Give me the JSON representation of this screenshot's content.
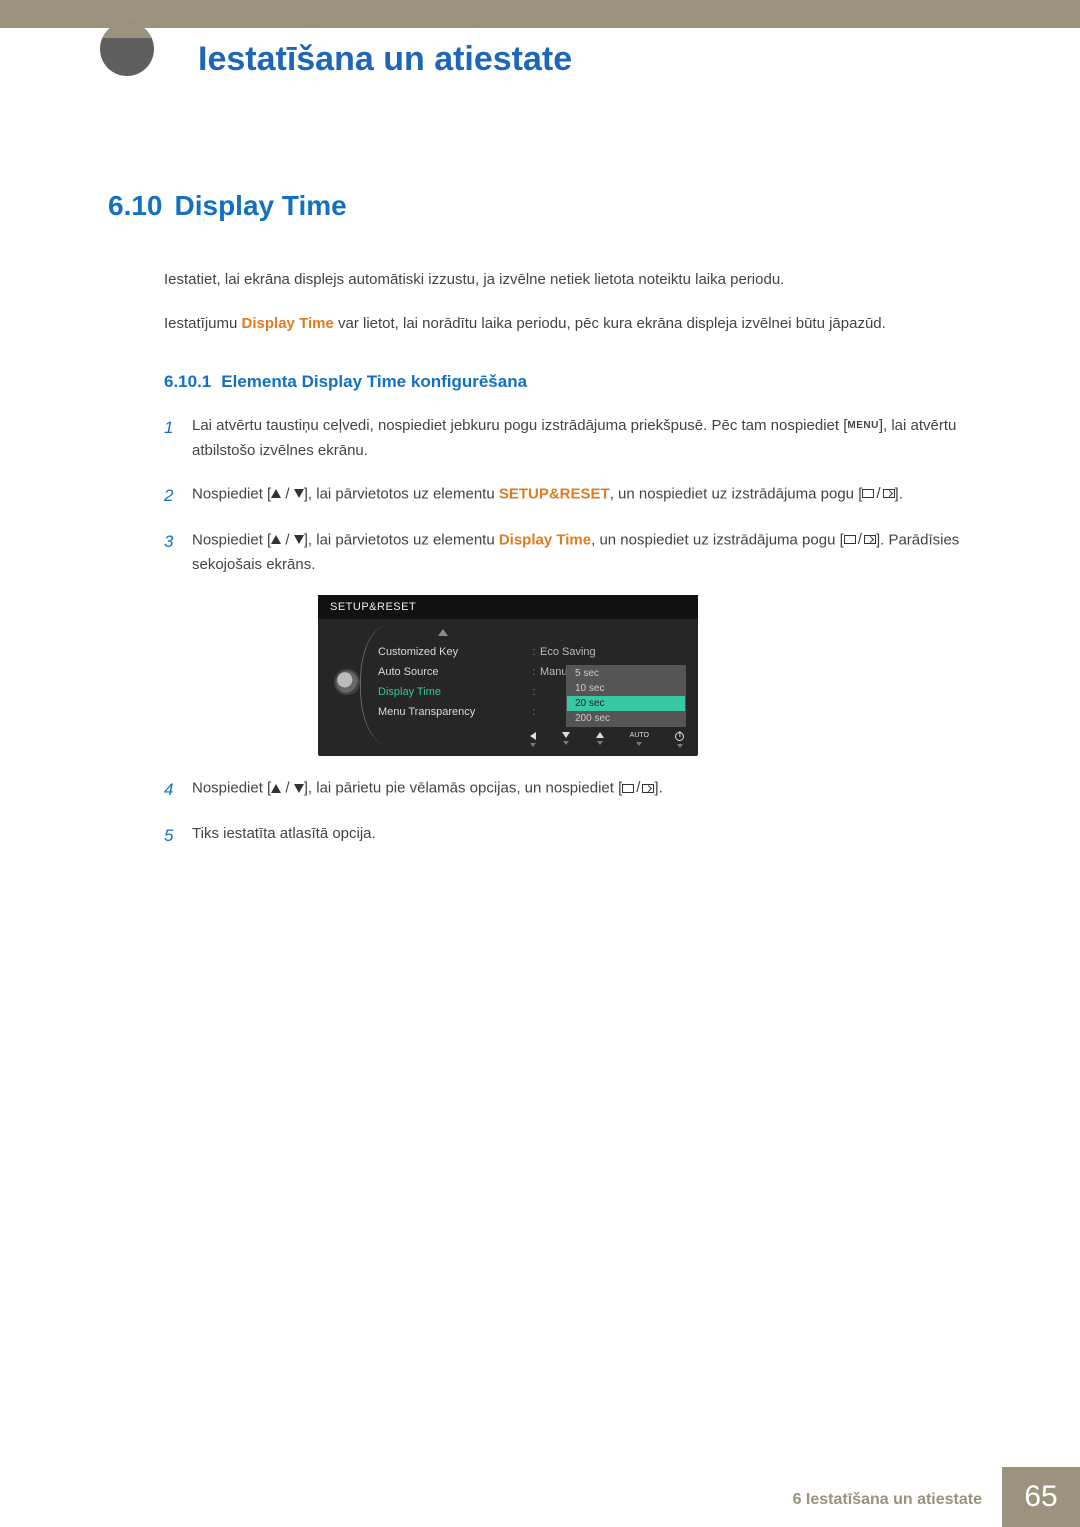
{
  "header": {
    "chapter_title": "Iestatīšana un atiestate"
  },
  "section": {
    "number": "6.10",
    "title": "Display Time",
    "intro1": "Iestatiet, lai ekrāna displejs automātiski izzustu, ja izvēlne netiek lietota noteiktu laika periodu.",
    "intro2_pre": "Iestatījumu ",
    "intro2_em": "Display Time",
    "intro2_post": " var lietot, lai norādītu laika periodu, pēc kura ekrāna displeja izvēlnei būtu jāpazūd."
  },
  "subsection": {
    "number": "6.10.1",
    "title": "Elementa Display Time konfigurēšana"
  },
  "steps": {
    "s1a": "Lai atvērtu taustiņu ceļvedi, nospiediet jebkuru pogu izstrādājuma priekšpusē. Pēc tam nospiediet [",
    "s1b": "], lai atvērtu atbilstošo izvēlnes ekrānu.",
    "menu_symbol": "MENU",
    "s2a": "Nospiediet [",
    "s2b": "], lai pārvietotos uz elementu ",
    "s2_em": "SETUP&RESET",
    "s2c": ", un nospiediet uz izstrādājuma pogu [",
    "s2d": "].",
    "s3a": "Nospiediet [",
    "s3b": "], lai pārvietotos uz elementu ",
    "s3_em": "Display Time",
    "s3c": ", un nospiediet uz izstrādājuma pogu [",
    "s3d": "]. Parādīsies sekojošais ekrāns.",
    "s4a": "Nospiediet [",
    "s4b": "], lai pārietu pie vēlamās opcijas, un nospiediet [",
    "s4c": "].",
    "s5": "Tiks iestatīta atlasītā opcija."
  },
  "osd": {
    "title": "SETUP&RESET",
    "r1_label": "Customized Key",
    "r1_value": "Eco Saving",
    "r2_label": "Auto Source",
    "r2_value": "Manual",
    "r3_label": "Display Time",
    "r4_label": "Menu Transparency",
    "opts": {
      "o1": "5 sec",
      "o2": "10 sec",
      "o3": "20 sec",
      "o4": "200 sec"
    },
    "auto": "AUTO"
  },
  "footer": {
    "text": "6 Iestatīšana un atiestate",
    "page": "65"
  }
}
